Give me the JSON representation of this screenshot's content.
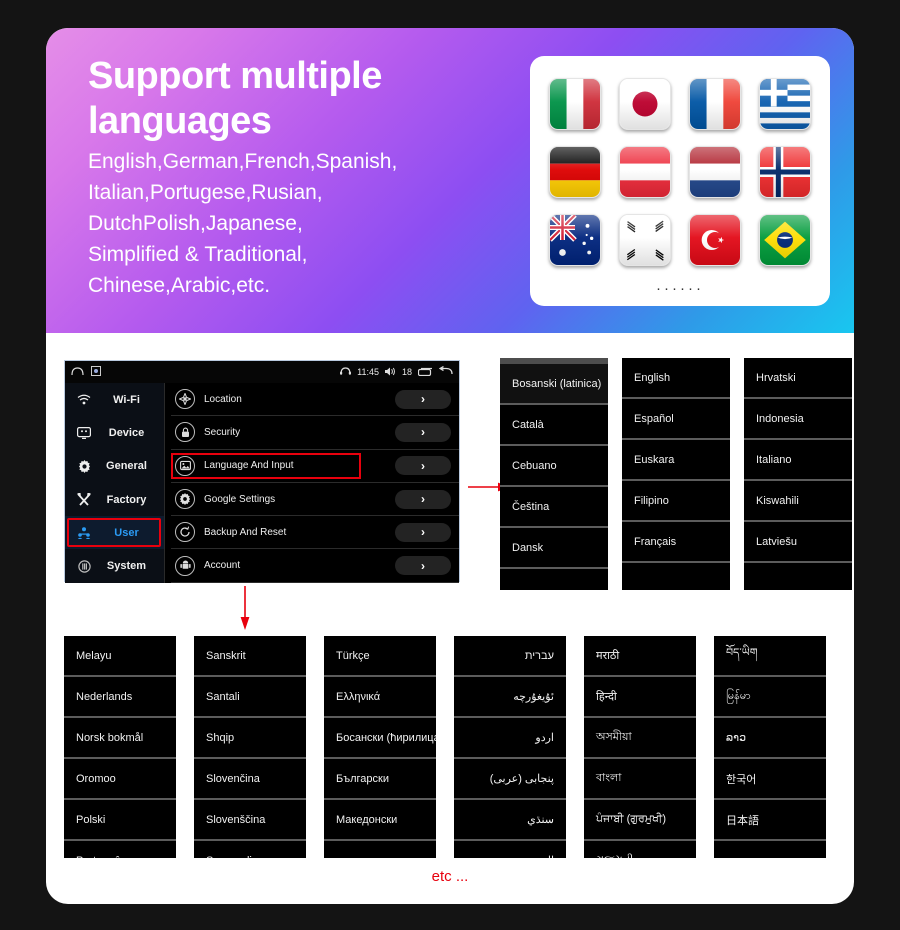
{
  "hero": {
    "title": "Support multiple languages",
    "lines": [
      "English,German,French,Spanish,",
      "Italian,Portugese,Rusian,",
      "DutchPolish,Japanese,",
      "Simplified & Traditional,",
      "Chinese,Arabic,etc."
    ],
    "gradient_from": "#e58ee8",
    "gradient_mid": "#8d4ef2",
    "gradient_to": "#18c8f0"
  },
  "flag_card": {
    "dots": "······",
    "flags": [
      {
        "name": "flag-italy",
        "label": "Italy"
      },
      {
        "name": "flag-japan",
        "label": "Japan"
      },
      {
        "name": "flag-france",
        "label": "France"
      },
      {
        "name": "flag-greece",
        "label": "Greece"
      },
      {
        "name": "flag-germany",
        "label": "Germany"
      },
      {
        "name": "flag-austria",
        "label": "Austria"
      },
      {
        "name": "flag-netherlands",
        "label": "Netherlands"
      },
      {
        "name": "flag-norway",
        "label": "Norway"
      },
      {
        "name": "flag-australia",
        "label": "Australia"
      },
      {
        "name": "flag-south-korea",
        "label": "South Korea"
      },
      {
        "name": "flag-turkey",
        "label": "Turkey"
      },
      {
        "name": "flag-brazil",
        "label": "Brazil"
      }
    ]
  },
  "android": {
    "statusbar": {
      "time": "11:45",
      "volume": "18"
    },
    "sidebar": [
      {
        "label": "Wi-Fi",
        "icon": "wifi-icon",
        "active": false
      },
      {
        "label": "Device",
        "icon": "device-icon",
        "active": false
      },
      {
        "label": "General",
        "icon": "gear-icon",
        "active": false
      },
      {
        "label": "Factory",
        "icon": "tools-icon",
        "active": false
      },
      {
        "label": "User",
        "icon": "user-icon",
        "active": true
      },
      {
        "label": "System",
        "icon": "system-icon",
        "active": false
      }
    ],
    "rows": [
      {
        "label": "Location",
        "icon": "location-icon",
        "chevron": "›",
        "highlighted": false
      },
      {
        "label": "Security",
        "icon": "lock-icon",
        "chevron": "›",
        "highlighted": false
      },
      {
        "label": "Language And Input",
        "icon": "language-icon",
        "chevron": "›",
        "highlighted": true
      },
      {
        "label": "Google Settings",
        "icon": "google-gear-icon",
        "chevron": "›",
        "highlighted": false
      },
      {
        "label": "Backup And Reset",
        "icon": "backup-icon",
        "chevron": "›",
        "highlighted": false
      },
      {
        "label": "Account",
        "icon": "android-icon",
        "chevron": "›",
        "highlighted": false
      }
    ],
    "highlight_color": "#e8000d",
    "active_color": "#2b9bf4"
  },
  "language_panels_top": [
    {
      "name": "lang-panel-1",
      "items": [
        "Bosanski (latinica)",
        "Català",
        "Cebuano",
        "Čeština",
        "Dansk"
      ]
    },
    {
      "name": "lang-panel-2",
      "items": [
        "English",
        "Español",
        "Euskara",
        "Filipino",
        "Français"
      ]
    },
    {
      "name": "lang-panel-3",
      "items": [
        "Hrvatski",
        "Indonesia",
        "Italiano",
        "Kiswahili",
        "Latviešu"
      ]
    }
  ],
  "language_panels_bottom": [
    {
      "name": "lang-panel-4",
      "rtl": false,
      "items": [
        "Melayu",
        "Nederlands",
        "Norsk bokmål",
        "Oromoo",
        "Polski",
        "Português"
      ]
    },
    {
      "name": "lang-panel-5",
      "rtl": false,
      "items": [
        "Sanskrit",
        "Santali",
        "Shqip",
        "Slovenčina",
        "Slovenščina",
        "Soomaali"
      ]
    },
    {
      "name": "lang-panel-6",
      "rtl": false,
      "items": [
        "Türkçe",
        "Ελληνικά",
        "Босански (ћирилица)",
        "Български",
        "Македонски",
        ""
      ]
    },
    {
      "name": "lang-panel-7",
      "rtl": true,
      "items": [
        "עברית",
        "ئۇيغۇرچە",
        "اردو",
        "پنجابی (عربی)",
        "سنڌي",
        "العربية"
      ]
    },
    {
      "name": "lang-panel-8",
      "rtl": false,
      "items": [
        "मराठी",
        "हिन्दी",
        "অসমীয়া",
        "বাংলা",
        "ਪੰਜਾਬੀ (ਗੁਰਮੁਖੀ)",
        "ગુજરાતી"
      ]
    },
    {
      "name": "lang-panel-9",
      "rtl": false,
      "items": [
        "བོད་ཡིག",
        "မြန်မာ",
        "ລາວ",
        "한국어",
        "日本語",
        ""
      ]
    }
  ],
  "footer": {
    "etc": "etc ...",
    "etc_color": "#e8000d"
  }
}
